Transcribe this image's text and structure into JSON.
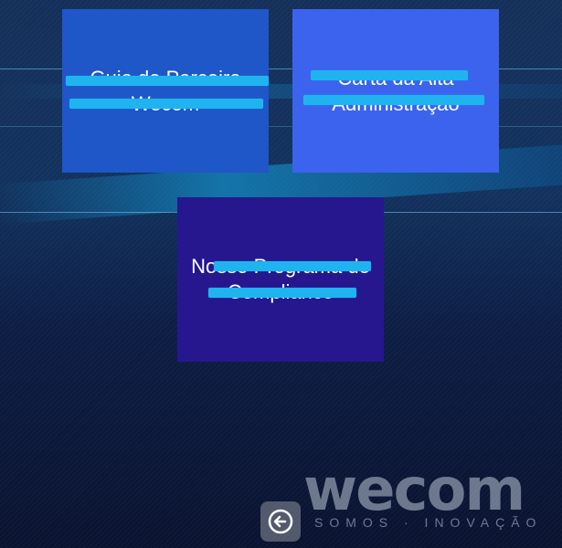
{
  "tiles": [
    {
      "title": "Guia do Parceiro Wecom",
      "color": "#1f56c8"
    },
    {
      "title": "Carta da Alta Administração",
      "color": "#3b63ee"
    },
    {
      "title": "Nosso Programa de Compliance",
      "color": "#26178f"
    }
  ],
  "logo": {
    "word": "wecom",
    "tagline": "SOMOS · INOVAÇÃO"
  },
  "back_button": {
    "icon": "arrow-left-circle-icon"
  }
}
